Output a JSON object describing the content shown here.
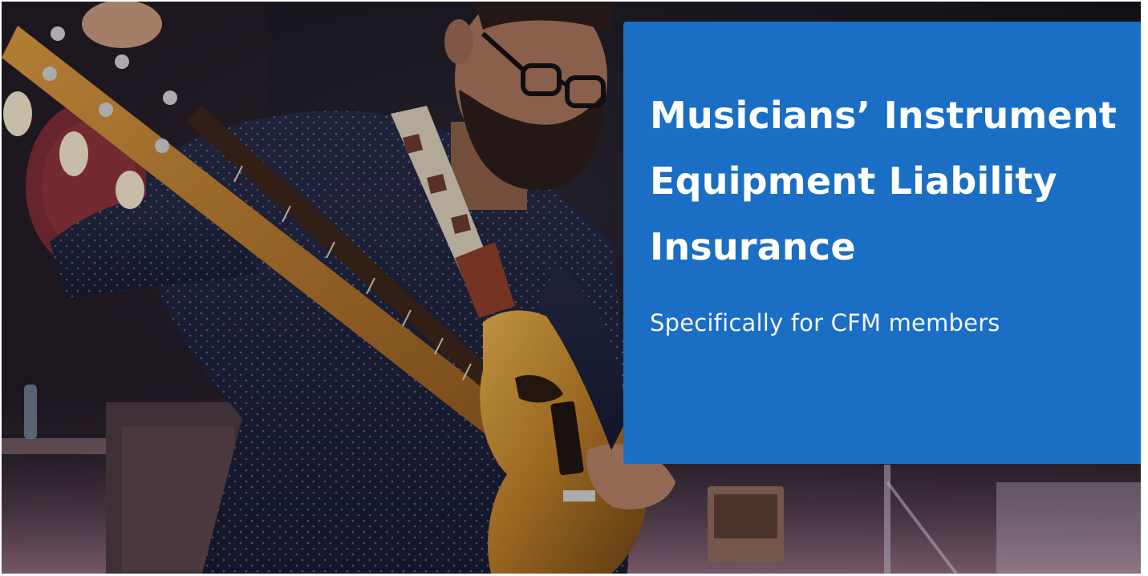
{
  "hero": {
    "image_alt": "Musician playing an electric guitar",
    "title": "Musicians’ Instrument\nEquipment Liability\nInsurance",
    "subtitle": "Specifically for CFM members"
  },
  "colors": {
    "callout_background": "#1a6ec3",
    "text": "#ffffff"
  }
}
